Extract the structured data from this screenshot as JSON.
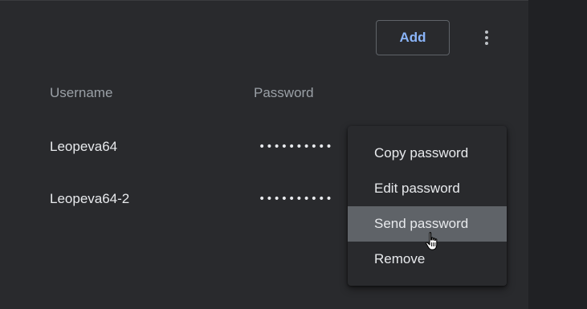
{
  "toolbar": {
    "add_label": "Add"
  },
  "table": {
    "columns": [
      "Username",
      "Password"
    ],
    "rows": [
      {
        "username": "Leopeva64",
        "password_mask": "••••••••••"
      },
      {
        "username": "Leopeva64-2",
        "password_mask": "••••••••••"
      }
    ]
  },
  "context_menu": {
    "items": [
      "Copy password",
      "Edit password",
      "Send password",
      "Remove"
    ],
    "highlighted": "Send password"
  },
  "icons": {
    "more": "more-vert-icon",
    "cursor": "hand-pointer-cursor-icon"
  },
  "colors": {
    "accent": "#8ab4f8",
    "panel": "#292a2d",
    "background": "#202124",
    "menu_highlight": "#5f6368"
  }
}
